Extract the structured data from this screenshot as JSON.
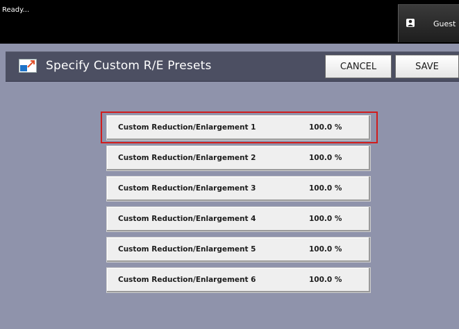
{
  "status": {
    "text": "Ready..."
  },
  "user": {
    "label": "Guest",
    "icon": "user-lock-icon"
  },
  "header": {
    "title": "Specify Custom R/E Presets",
    "icon": "reduce-enlarge-icon",
    "cancel_label": "CANCEL",
    "save_label": "SAVE"
  },
  "presets": [
    {
      "label": "Custom Reduction/Enlargement  1",
      "value": "100.0  %"
    },
    {
      "label": "Custom Reduction/Enlargement  2",
      "value": "100.0  %"
    },
    {
      "label": "Custom Reduction/Enlargement  3",
      "value": "100.0  %"
    },
    {
      "label": "Custom Reduction/Enlargement  4",
      "value": "100.0  %"
    },
    {
      "label": "Custom Reduction/Enlargement  5",
      "value": "100.0  %"
    },
    {
      "label": "Custom Reduction/Enlargement  6",
      "value": "100.0  %"
    }
  ],
  "highlight": {
    "selected_index": 0,
    "color": "#d11c1c"
  }
}
